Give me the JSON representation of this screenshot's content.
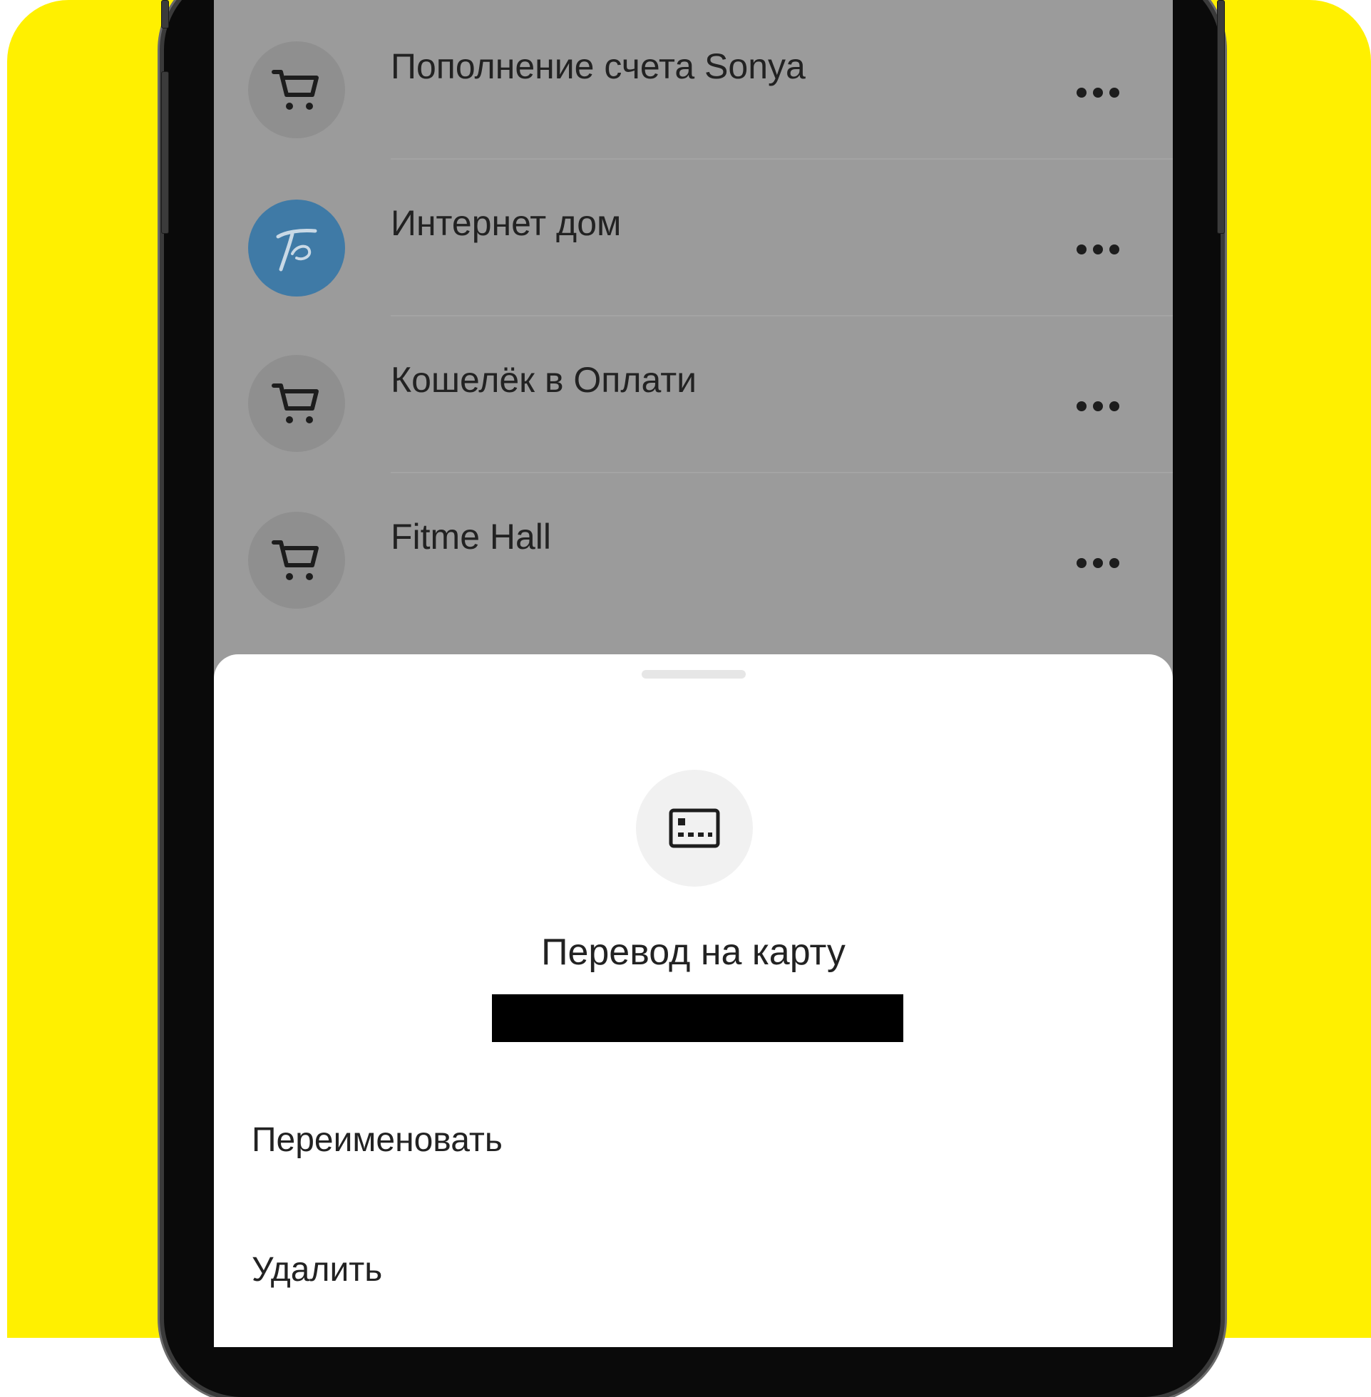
{
  "colors": {
    "background_accent": "#FFF000",
    "overlay_dim": "#9b9b9b",
    "brand_avatar": "#3f7aa6",
    "sheet_background": "#ffffff",
    "text_primary": "#222222"
  },
  "list": {
    "items": [
      {
        "title": "Пополнение счета Sonya",
        "icon": "cart-icon"
      },
      {
        "title": "Интернет дом",
        "icon": "provider-logo"
      },
      {
        "title": "Кошелёк в Оплати",
        "icon": "cart-icon"
      },
      {
        "title": "Fitme Hall",
        "icon": "cart-icon"
      }
    ],
    "more_icon": "more-dots-icon"
  },
  "sheet": {
    "icon": "card-icon",
    "title": "Перевод на карту",
    "actions": [
      {
        "label": "Переименовать"
      },
      {
        "label": "Удалить"
      }
    ]
  }
}
